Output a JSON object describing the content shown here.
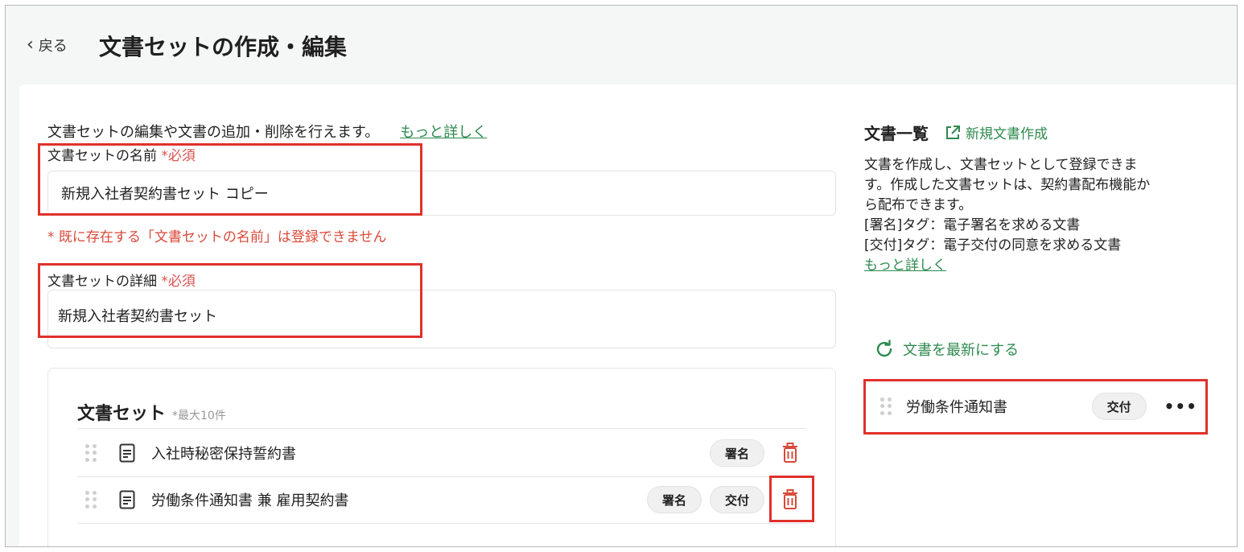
{
  "header": {
    "back_label": "戻る",
    "title": "文書セットの作成・編集"
  },
  "intro": {
    "text": "文書セットの編集や文書の追加・削除を行えます。",
    "more_link": "もっと詳しく"
  },
  "fields": {
    "name": {
      "label": "文書セットの名前",
      "required": "*必須",
      "value": "新規入社者契約書セット コピー",
      "error": "* 既に存在する「文書セットの名前」は登録できません"
    },
    "detail": {
      "label": "文書セットの詳細",
      "required": "*必須",
      "value": "新規入社者契約書セット"
    }
  },
  "document_set": {
    "title": "文書セット",
    "note": "*最大10件",
    "items": [
      {
        "name": "入社時秘密保持誓約書",
        "tags": [
          "署名"
        ]
      },
      {
        "name": "労働条件通知書 兼 雇用契約書",
        "tags": [
          "署名",
          "交付"
        ]
      }
    ]
  },
  "document_list": {
    "title": "文書一覧",
    "new_doc_label": "新規文書作成",
    "description_lines": [
      "文書を作成し、文書セットとして登録できま",
      "す。作成した文書セットは、契約書配布機能か",
      "ら配布できます。",
      "[署名]タグ：電子署名を求める文書",
      "[交付]タグ：電子交付の同意を求める文書"
    ],
    "more_link": "もっと詳しく",
    "refresh_label": "文書を最新にする",
    "items": [
      {
        "name": "労働条件通知書",
        "tag": "交付",
        "menu": "•••"
      }
    ]
  },
  "colors": {
    "accent_green": "#2e8a4f",
    "required_red": "#d9534f",
    "highlight_red": "#e0312b"
  }
}
